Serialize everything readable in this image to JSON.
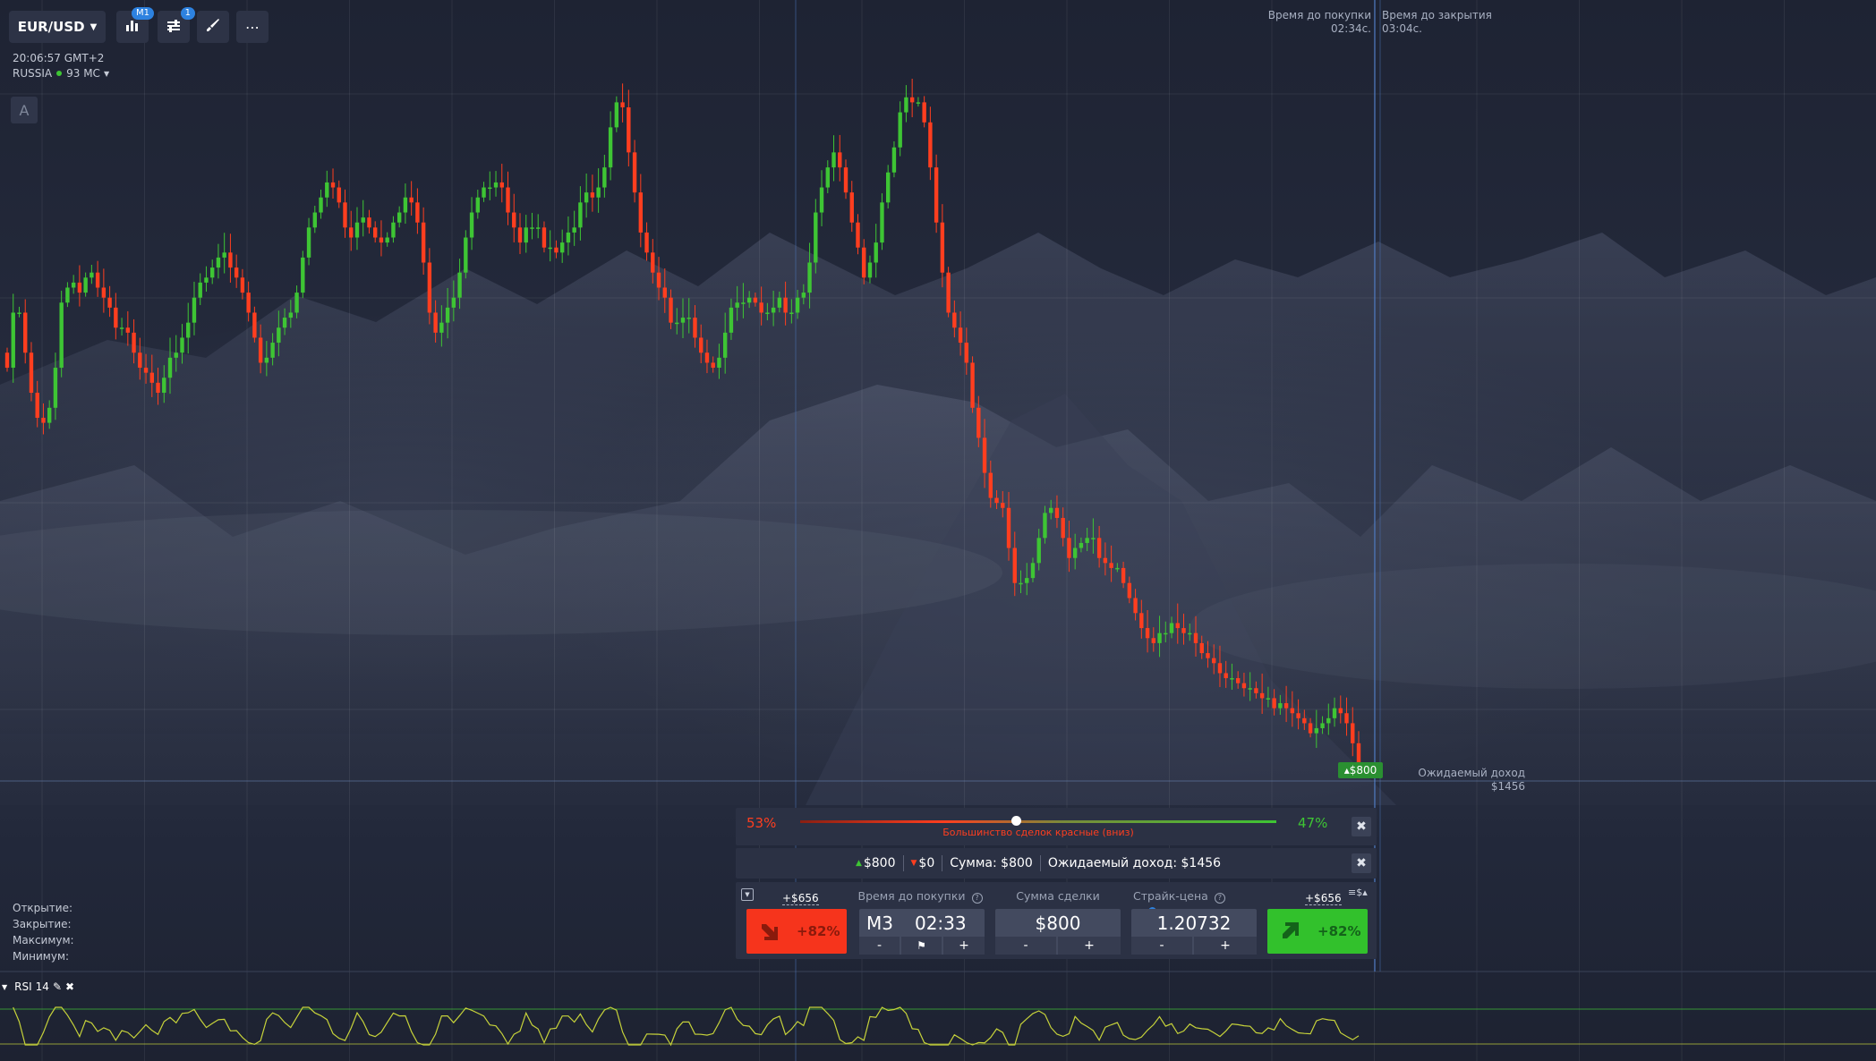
{
  "toolbar": {
    "pair": "EUR/USD",
    "timeframe_badge": "M1",
    "indicators_badge": "1",
    "more_label": "⋯"
  },
  "info": {
    "time": "20:06:57 GMT+2",
    "country": "RUSSIA",
    "ping": "93 MC",
    "auto_label": "A"
  },
  "timers": {
    "buy_label": "Время до покупки",
    "buy_value": "02:34с.",
    "close_label": "Время до закрытия",
    "close_value": "03:04с."
  },
  "expected_income": {
    "label": "Ожидаемый доход",
    "value": "$1456"
  },
  "price_tag": "▴$800",
  "sentiment": {
    "red_percent": "53%",
    "green_percent": "47%",
    "caption": "Большинство сделок красные (вниз)",
    "position": 0.46
  },
  "summary": {
    "up": "$800",
    "down": "$0",
    "sum": "Сумма: $800",
    "expected": "Ожидаемый доход: $1456"
  },
  "trade": {
    "profit_left": "+$656",
    "profit_right": "+$656",
    "time_label": "Время до покупки",
    "time_mode": "M3",
    "time_value": "02:33",
    "amount_label": "Сумма сделки",
    "amount_value": "$800",
    "strike_label": "Страйк-цена",
    "strike_value": "1.20732",
    "down_percent": "+82%",
    "up_percent": "+82%",
    "minus": "-",
    "plus": "+",
    "currency_switch": "≡$▴"
  },
  "ohlc": {
    "open": "Открытие:",
    "close": "Закрытие:",
    "high": "Максимум:",
    "low": "Минимум:"
  },
  "rsi": {
    "label": "RSI",
    "period": "14"
  },
  "colors": {
    "up": "#3ec534",
    "down": "#ff3e1f",
    "accent": "#2d82e0",
    "rsi_line": "#c6d23a"
  },
  "chart_data": {
    "type": "candlestick",
    "symbol": "EUR/USD",
    "timeframe": "M1",
    "closes": [
      0.55,
      0.66,
      0.66,
      0.58,
      0.5,
      0.45,
      0.44,
      0.47,
      0.55,
      0.68,
      0.71,
      0.72,
      0.7,
      0.73,
      0.74,
      0.71,
      0.69,
      0.67,
      0.63,
      0.63,
      0.62,
      0.58,
      0.55,
      0.54,
      0.52,
      0.5,
      0.53,
      0.57,
      0.58,
      0.61,
      0.64,
      0.69,
      0.72,
      0.73,
      0.75,
      0.77,
      0.78,
      0.75,
      0.73,
      0.7,
      0.66,
      0.61,
      0.56,
      0.57,
      0.6,
      0.63,
      0.65,
      0.66,
      0.7,
      0.77,
      0.83,
      0.86,
      0.89,
      0.92,
      0.91,
      0.88,
      0.83,
      0.81,
      0.84,
      0.85,
      0.83,
      0.81,
      0.8,
      0.81,
      0.84,
      0.86,
      0.89,
      0.88,
      0.84,
      0.76,
      0.66,
      0.62,
      0.64,
      0.67,
      0.69,
      0.74,
      0.81,
      0.86,
      0.89,
      0.91,
      0.91,
      0.92,
      0.91,
      0.86,
      0.83,
      0.8,
      0.83,
      0.83,
      0.83,
      0.79,
      0.79,
      0.78,
      0.8,
      0.82,
      0.83,
      0.88,
      0.9,
      0.89,
      0.91,
      0.95,
      1.03,
      1.08,
      1.07,
      0.98,
      0.9,
      0.82,
      0.78,
      0.74,
      0.71,
      0.69,
      0.64,
      0.64,
      0.65,
      0.65,
      0.61,
      0.58,
      0.56,
      0.55,
      0.57,
      0.62,
      0.67,
      0.68,
      0.68,
      0.69,
      0.68,
      0.66,
      0.66,
      0.67,
      0.69,
      0.66,
      0.66,
      0.69,
      0.7,
      0.76,
      0.86,
      0.91,
      0.95,
      0.98,
      0.95,
      0.9,
      0.84,
      0.79,
      0.73,
      0.76,
      0.8,
      0.88,
      0.94,
      0.99,
      1.06,
      1.09,
      1.08,
      1.08,
      1.04,
      0.95,
      0.84,
      0.74,
      0.66,
      0.63,
      0.6,
      0.56,
      0.47,
      0.41,
      0.34,
      0.29,
      0.28,
      0.27,
      0.19,
      0.12,
      0.12,
      0.13,
      0.16,
      0.21,
      0.26,
      0.27,
      0.25,
      0.21,
      0.17,
      0.19,
      0.2,
      0.21,
      0.21,
      0.17,
      0.16,
      0.15,
      0.15,
      0.12,
      0.09,
      0.06,
      0.03,
      0.01,
      0.0,
      0.02,
      0.02,
      0.04,
      0.03,
      0.02,
      0.02,
      0.0,
      -0.02,
      -0.03,
      -0.04,
      -0.06,
      -0.07,
      -0.07,
      -0.08,
      -0.09,
      -0.09,
      -0.1,
      -0.11,
      -0.11,
      -0.13,
      -0.12,
      -0.13,
      -0.14,
      -0.15,
      -0.16,
      -0.18,
      -0.17,
      -0.16,
      -0.15,
      -0.13,
      -0.14,
      -0.16,
      -0.2,
      -0.24
    ]
  }
}
